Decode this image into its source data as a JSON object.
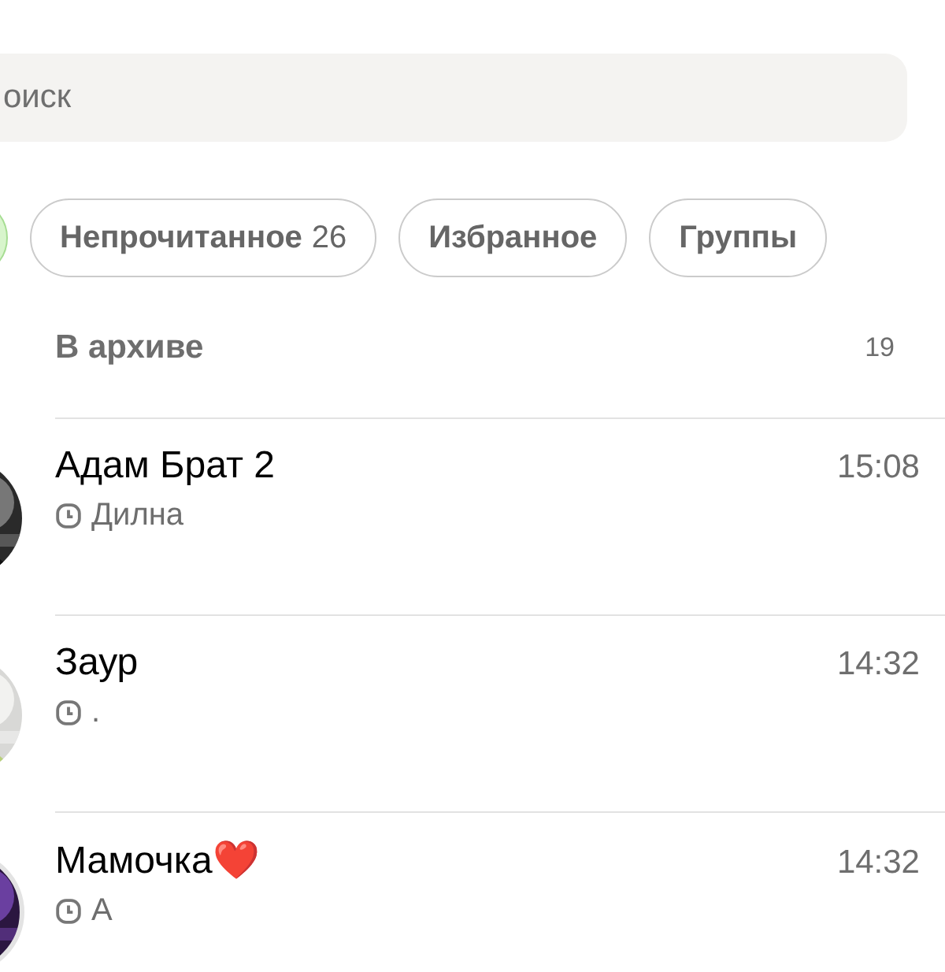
{
  "search": {
    "placeholder": "оиск"
  },
  "filters": [
    {
      "selected": true
    },
    {
      "label": "Непрочитанное",
      "count": "26",
      "selected": false
    },
    {
      "label": "Избранное",
      "selected": false
    },
    {
      "label": "Группы",
      "selected": false
    }
  ],
  "archive": {
    "label": "В архиве",
    "count": "19"
  },
  "chats": [
    {
      "name": "Адам Брат 2",
      "preview": "Дилна",
      "time": "15:08"
    },
    {
      "name": "Заур",
      "preview": ".",
      "time": "14:32"
    },
    {
      "name": "Мамочка❤️",
      "preview": "А",
      "time": "14:32"
    }
  ]
}
